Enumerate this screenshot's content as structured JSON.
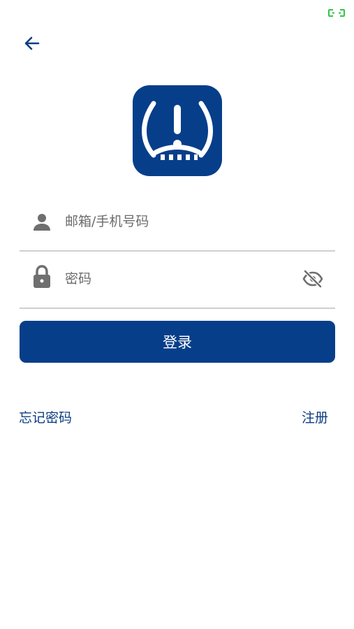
{
  "status_bar": {
    "indicator_icon": "battery-charging-icon",
    "indicator_color": "#2fc64a"
  },
  "header": {
    "back_icon": "arrow-left-icon"
  },
  "logo": {
    "icon": "tire-pressure-warning-icon",
    "background_color": "#063e8a"
  },
  "login_form": {
    "account_placeholder": "邮箱/手机号码",
    "password_placeholder": "密码",
    "account_icon": "user-icon",
    "password_icon": "lock-icon",
    "visibility_icon": "eye-off-icon",
    "submit_label": "登录"
  },
  "links": {
    "forgot_password": "忘记密码",
    "register": "注册"
  },
  "colors": {
    "primary": "#063e8a",
    "link": "#0b3d82",
    "divider": "#cfcfcf",
    "icon_gray": "#6f6f6f"
  }
}
